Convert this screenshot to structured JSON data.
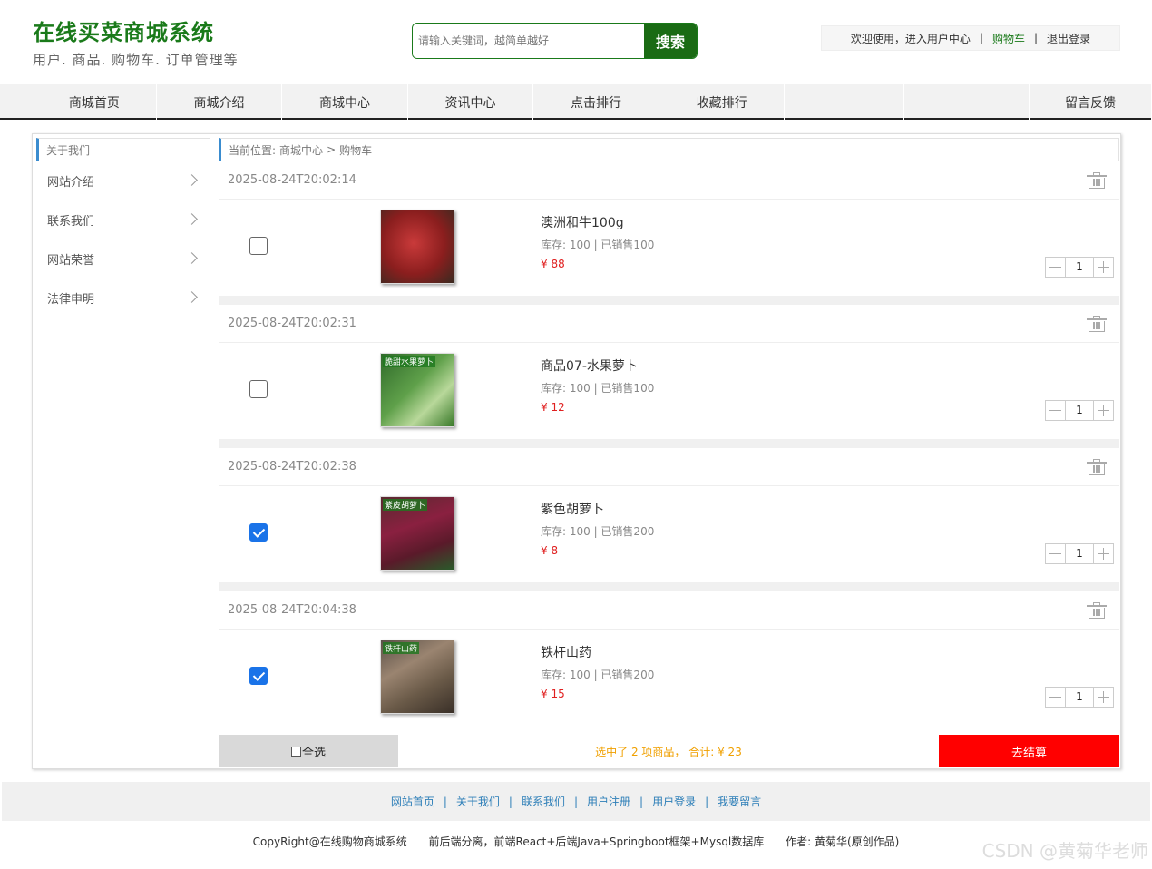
{
  "brand": {
    "title": "在线买菜商城系统",
    "subtitle": "用户. 商品. 购物车. 订单管理等"
  },
  "search": {
    "placeholder": "请输入关键词，越简单越好",
    "button": "搜索"
  },
  "userbar": {
    "welcome": "欢迎使用，进入用户中心",
    "cart": "购物车",
    "logout": "退出登录",
    "sep": "|"
  },
  "nav": {
    "home": "商城首页",
    "intro": "商城介绍",
    "center": "商城中心",
    "news": "资讯中心",
    "hot": "点击排行",
    "fav": "收藏排行",
    "msg": "留言反馈"
  },
  "sidebar": {
    "head": "关于我们",
    "items": [
      {
        "label": "网站介绍"
      },
      {
        "label": "联系我们"
      },
      {
        "label": "网站荣誉"
      },
      {
        "label": "法律申明"
      }
    ]
  },
  "breadcrumb": {
    "label": "当前位置:",
    "level1": "商城中心",
    "sep": ">",
    "level2": "购物车"
  },
  "cart": {
    "items": [
      {
        "date": "2025-08-24T20:02:14",
        "name": "澳洲和牛100g",
        "stock": "库存: 100 | 已销售100",
        "price": "¥ 88",
        "qty": "1",
        "checked": false,
        "thumb_caption": "",
        "thumb_color": "#8b1e1e"
      },
      {
        "date": "2025-08-24T20:02:31",
        "name": "商品07-水果萝卜",
        "stock": "库存: 100 | 已销售100",
        "price": "¥ 12",
        "qty": "1",
        "checked": false,
        "thumb_caption": "脆甜水果萝卜",
        "thumb_color": "#4a8a3a"
      },
      {
        "date": "2025-08-24T20:02:38",
        "name": "紫色胡萝卜",
        "stock": "库存: 100 | 已销售200",
        "price": "¥ 8",
        "qty": "1",
        "checked": true,
        "thumb_caption": "紫皮胡萝卜",
        "thumb_color": "#7a1f3a"
      },
      {
        "date": "2025-08-24T20:04:38",
        "name": "铁杆山药",
        "stock": "库存: 100 | 已销售200",
        "price": "¥ 15",
        "qty": "1",
        "checked": true,
        "thumb_caption": "铁杆山药",
        "thumb_color": "#7b6a55"
      }
    ],
    "select_all": "全选",
    "summary": "选中了 2 项商品， 合计: ¥ 23",
    "checkout": "去结算"
  },
  "footer": {
    "links": [
      "网站首页",
      "关于我们",
      "联系我们",
      "用户注册",
      "用户登录",
      "我要留言"
    ],
    "copyright": "CopyRight@在线购物商城系统",
    "tech": "前后端分离，前端React+后端Java+Springboot框架+Mysql数据库",
    "author": "作者: 黄菊华(原创作品)",
    "watermark": "CSDN @黄菊华老师"
  },
  "colors": {
    "brand_green": "#1a7a1a",
    "price_red": "#e02020",
    "checkout_red": "#ff0000",
    "summary_orange": "#f0a000",
    "link_blue": "#2e7fb8"
  }
}
